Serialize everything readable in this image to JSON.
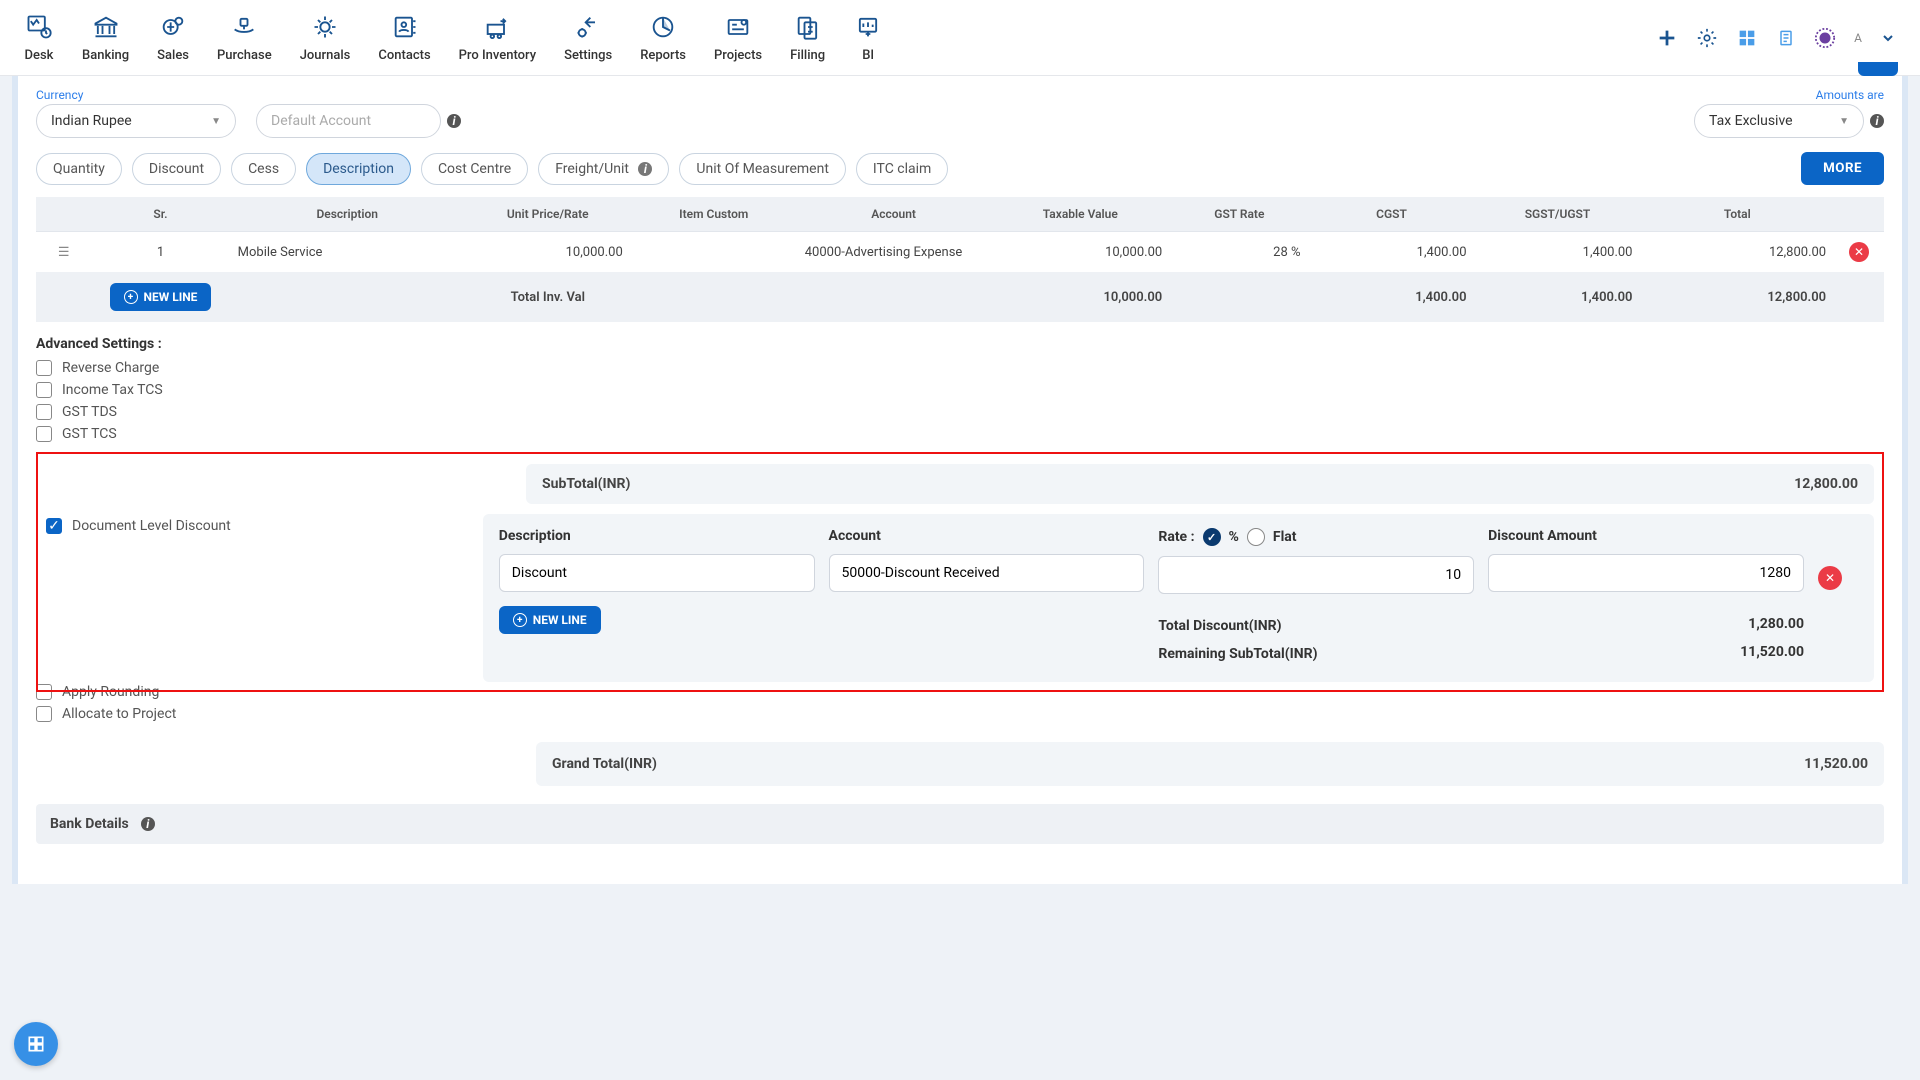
{
  "nav": {
    "items": [
      {
        "label": "Desk"
      },
      {
        "label": "Banking"
      },
      {
        "label": "Sales"
      },
      {
        "label": "Purchase"
      },
      {
        "label": "Journals"
      },
      {
        "label": "Contacts"
      },
      {
        "label": "Pro Inventory"
      },
      {
        "label": "Settings"
      },
      {
        "label": "Reports"
      },
      {
        "label": "Projects"
      },
      {
        "label": "Filling"
      },
      {
        "label": "BI"
      }
    ],
    "user_initial": "A"
  },
  "form": {
    "currency_label": "Currency",
    "currency_value": "Indian Rupee",
    "default_account_placeholder": "Default Account",
    "amounts_label": "Amounts are",
    "amounts_value": "Tax Exclusive"
  },
  "pills": [
    "Quantity",
    "Discount",
    "Cess",
    "Description",
    "Cost Centre",
    "Freight/Unit",
    "Unit Of Measurement",
    "ITC claim"
  ],
  "active_pill": "Description",
  "more_btn": "MORE",
  "table": {
    "headers": [
      "Sr.",
      "Description",
      "Unit Price/Rate",
      "Item Custom",
      "Account",
      "Taxable Value",
      "GST Rate",
      "CGST",
      "SGST/UGST",
      "Total"
    ],
    "rows": [
      {
        "sr": "1",
        "desc": "Mobile Service",
        "price": "10,000.00",
        "custom": "",
        "account": "40000-Advertising Expense",
        "taxable": "10,000.00",
        "gst": "28 %",
        "cgst": "1,400.00",
        "sgst": "1,400.00",
        "total": "12,800.00"
      }
    ],
    "totals_label": "Total Inv. Val",
    "totals": {
      "taxable": "10,000.00",
      "cgst": "1,400.00",
      "sgst": "1,400.00",
      "total": "12,800.00"
    },
    "newline": "NEW LINE"
  },
  "advanced": {
    "title": "Advanced Settings :",
    "options": [
      "Reverse Charge",
      "Income Tax TCS",
      "GST TDS",
      "GST TCS"
    ]
  },
  "subtotal": {
    "label": "SubTotal(INR)",
    "value": "12,800.00"
  },
  "doc_discount": {
    "checkbox_label": "Document Level Discount",
    "headers": {
      "desc": "Description",
      "account": "Account",
      "rate": "Rate :",
      "pct": "%",
      "flat": "Flat",
      "amount": "Discount Amount"
    },
    "row": {
      "desc": "Discount",
      "account": "50000-Discount Received",
      "rate": "10",
      "amount": "1280"
    },
    "newline": "NEW LINE",
    "total_disc_label": "Total Discount(INR)",
    "total_disc_value": "1,280.00",
    "remaining_label": "Remaining SubTotal(INR)",
    "remaining_value": "11,520.00"
  },
  "post_options": [
    "Apply Rounding",
    "Allocate to Project"
  ],
  "grand": {
    "label": "Grand Total(INR)",
    "value": "11,520.00"
  },
  "bank_details": "Bank Details"
}
